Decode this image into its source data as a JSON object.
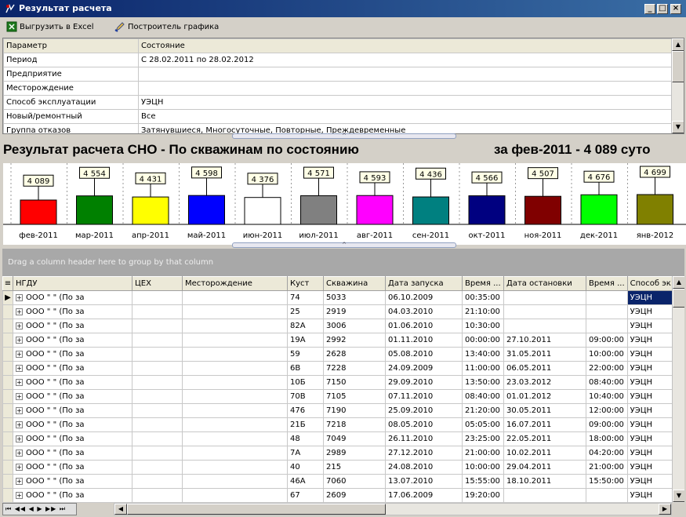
{
  "window": {
    "title": "Результат расчета"
  },
  "toolbar": {
    "export_label": "Выгрузить в Excel",
    "chart_label": "Построитель графика"
  },
  "params": {
    "headers": [
      "Параметр",
      "Состояние"
    ],
    "rows": [
      [
        "Период",
        "С 28.02.2011 по 28.02.2012"
      ],
      [
        "Предприятие",
        ""
      ],
      [
        "Месторождение",
        ""
      ],
      [
        "Способ эксплуатации",
        "УЭЦН"
      ],
      [
        "Новый/ремонтный",
        "Все"
      ],
      [
        "Группа отказов",
        "Затянувшиеся, Многосуточные, Повторные, Преждевременные"
      ]
    ]
  },
  "chart_title": "Результат расчета СНО - По скважинам по состоянию",
  "chart_title_right": "за фев-2011 - 4 089   суто",
  "chart_data": {
    "type": "bar",
    "categories": [
      "фев-2011",
      "мар-2011",
      "апр-2011",
      "май-2011",
      "июн-2011",
      "июл-2011",
      "авг-2011",
      "сен-2011",
      "окт-2011",
      "ноя-2011",
      "дек-2011",
      "янв-2012"
    ],
    "values": [
      4089,
      4554,
      4431,
      4598,
      4376,
      4571,
      4593,
      4436,
      4566,
      4507,
      4676,
      4699
    ],
    "labels": [
      "4 089",
      "4 554",
      "4 431",
      "4 598",
      "4 376",
      "4 571",
      "4 593",
      "4 436",
      "4 566",
      "4 507",
      "4 676",
      "4 699"
    ],
    "colors": [
      "#ff0000",
      "#008000",
      "#ffff00",
      "#0000ff",
      "#ffffff",
      "#808080",
      "#ff00ff",
      "#008080",
      "#000080",
      "#800000",
      "#00ff00",
      "#808000"
    ]
  },
  "group_panel_text": "Drag a column header here to group by that column",
  "grid": {
    "columns": [
      "НГДУ",
      "ЦЕХ",
      "Месторождение",
      "Куст",
      "Скважина",
      "Дата запуска",
      "Время ...",
      "Дата остановки",
      "Время ...",
      "Способ эк"
    ],
    "rows": [
      [
        "ООО \"            \" (По за",
        "",
        "",
        "74",
        "5033",
        "06.10.2009",
        "00:35:00",
        "",
        "",
        "УЭЦН"
      ],
      [
        "ООО \"            \" (По за",
        "",
        "",
        "25",
        "2919",
        "04.03.2010",
        "21:10:00",
        "",
        "",
        "УЭЦН"
      ],
      [
        "ООО \"            \" (По за",
        "",
        "",
        "82А",
        "3006",
        "01.06.2010",
        "10:30:00",
        "",
        "",
        "УЭЦН"
      ],
      [
        "ООО \"            \" (По за",
        "",
        "",
        "19А",
        "2992",
        "01.11.2010",
        "00:00:00",
        "27.10.2011",
        "09:00:00",
        "УЭЦН"
      ],
      [
        "ООО \"            \" (По за",
        "",
        "",
        "59",
        "2628",
        "05.08.2010",
        "13:40:00",
        "31.05.2011",
        "10:00:00",
        "УЭЦН"
      ],
      [
        "ООО \"            \" (По за",
        "",
        "",
        "6В",
        "7228",
        "24.09.2009",
        "11:00:00",
        "06.05.2011",
        "22:00:00",
        "УЭЦН"
      ],
      [
        "ООО \"            \" (По за",
        "",
        "",
        "10Б",
        "7150",
        "29.09.2010",
        "13:50:00",
        "23.03.2012",
        "08:40:00",
        "УЭЦН"
      ],
      [
        "ООО \"            \" (По за",
        "",
        "",
        "70В",
        "7105",
        "07.11.2010",
        "08:40:00",
        "01.01.2012",
        "10:40:00",
        "УЭЦН"
      ],
      [
        "ООО \"            \" (По за",
        "",
        "",
        "476",
        "7190",
        "25.09.2010",
        "21:20:00",
        "30.05.2011",
        "12:00:00",
        "УЭЦН"
      ],
      [
        "ООО \"            \" (По за",
        "",
        "",
        "21Б",
        "7218",
        "08.05.2010",
        "05:05:00",
        "16.07.2011",
        "09:00:00",
        "УЭЦН"
      ],
      [
        "ООО \"            \" (По за",
        "",
        "",
        "48",
        "7049",
        "26.11.2010",
        "23:25:00",
        "22.05.2011",
        "18:00:00",
        "УЭЦН"
      ],
      [
        "ООО \"            \" (По за",
        "",
        "",
        "7А",
        "2989",
        "27.12.2010",
        "21:00:00",
        "10.02.2011",
        "04:20:00",
        "УЭЦН"
      ],
      [
        "ООО \"            \" (По за",
        "",
        "",
        "40",
        "215",
        "24.08.2010",
        "10:00:00",
        "29.04.2011",
        "21:00:00",
        "УЭЦН"
      ],
      [
        "ООО \"            \" (По за",
        "",
        "",
        "46А",
        "7060",
        "13.07.2010",
        "15:55:00",
        "18.10.2011",
        "15:50:00",
        "УЭЦН"
      ],
      [
        "ООО \"            \" (По за",
        "",
        "",
        "67",
        "2609",
        "17.06.2009",
        "19:20:00",
        "",
        "",
        "УЭЦН"
      ]
    ]
  }
}
